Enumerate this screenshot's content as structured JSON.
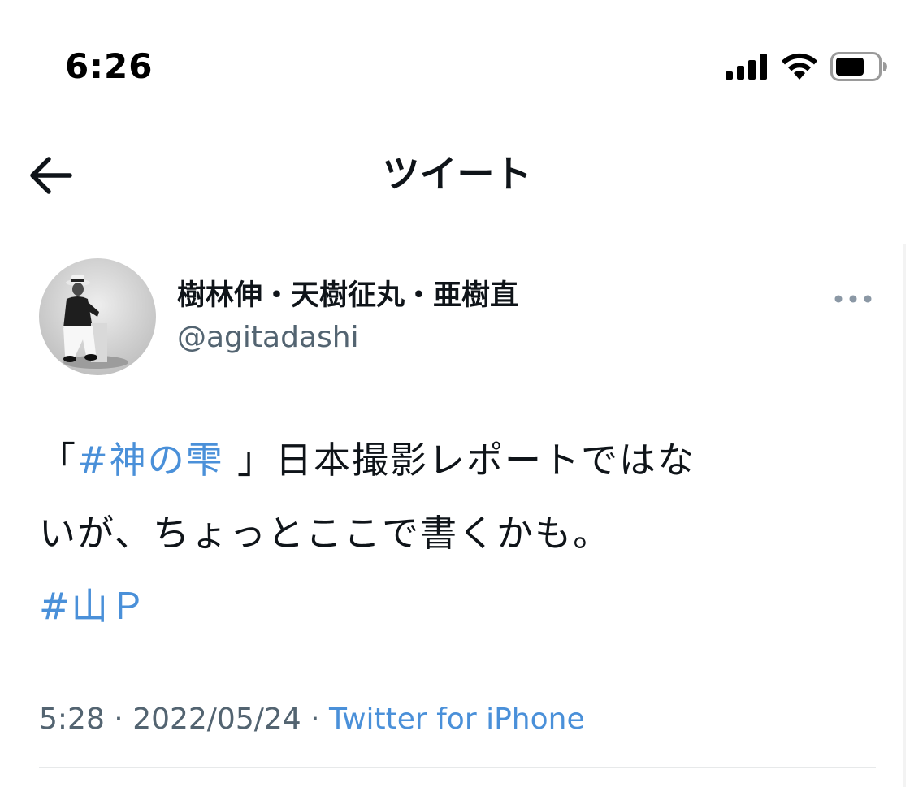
{
  "status_bar": {
    "time": "6:26",
    "signal_icon": "cellular-signal-icon",
    "wifi_icon": "wifi-icon",
    "battery_icon": "battery-icon"
  },
  "header": {
    "back_icon": "back-arrow-icon",
    "title": "ツイート"
  },
  "tweet": {
    "author": {
      "display_name": "樹林伸・天樹征丸・亜樹直",
      "handle": "@agitadashi"
    },
    "more_icon": "more-dots-icon",
    "body": {
      "line1_open_bracket": "「",
      "line1_hashtag": "#神の雫",
      "line1_rest": " 」日本撮影レポートではな",
      "line2": "いが、ちょっとここで書くかも。",
      "line3_hashtag": "#山Ｐ"
    },
    "meta": {
      "time": "5:28",
      "separator1": " · ",
      "date": "2022/05/24",
      "separator2": " · ",
      "source": "Twitter for iPhone"
    }
  },
  "colors": {
    "text": "#0f1419",
    "secondary": "#536471",
    "link": "#4a90d9",
    "divider": "#e7e9ea"
  }
}
